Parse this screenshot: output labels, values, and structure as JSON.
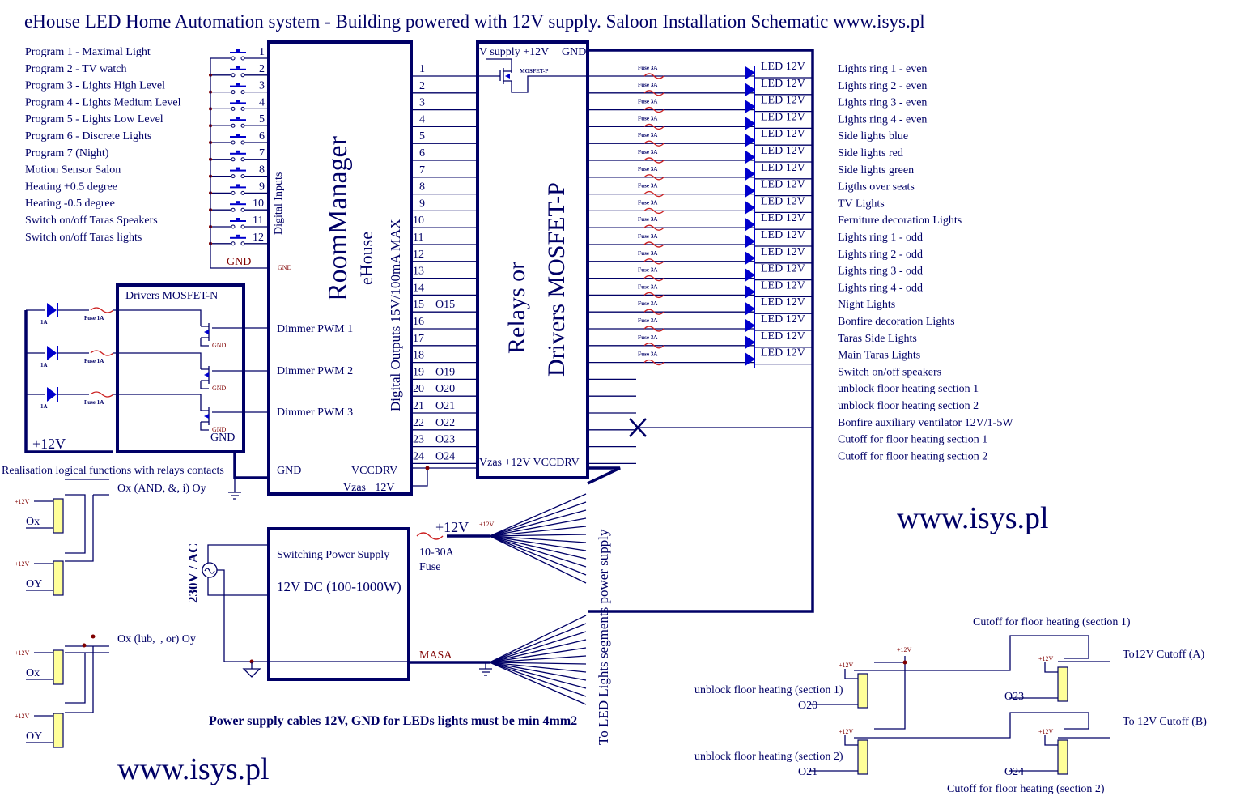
{
  "title": "eHouse LED Home Automation system - Building powered with 12V supply. Saloon Installation Schematic  www.isys.pl",
  "inputs": {
    "labels": [
      "Program 1 - Maximal Light",
      "Program 2 - TV watch",
      "Program 3 - Lights High Level",
      "Program 4 - Lights Medium Level",
      "Program 5 - Lights Low Level",
      "Program 6 - Discrete Lights",
      "Program 7 (Night)",
      "Motion Sensor Salon",
      "Heating +0.5 degree",
      "Heating -0.5 degree",
      "Switch on/off Taras Speakers",
      "Switch on/off Taras lights"
    ],
    "pins": [
      "1",
      "2",
      "3",
      "4",
      "5",
      "6",
      "7",
      "8",
      "9",
      "10",
      "11",
      "12"
    ],
    "gnd_label": "GND",
    "gnd_small": "GND",
    "section_label": "Digital Inputs"
  },
  "room_manager": {
    "name": "RoomManager",
    "brand": "eHouse",
    "outputs_label": "Digital Outputs 15V/100mA MAX",
    "dimmers": [
      "Dimmer PWM 1",
      "Dimmer PWM 2",
      "Dimmer PWM 3"
    ],
    "gnd": "GND",
    "vccdrv": "VCCDRV",
    "vzas": "Vzas +12V",
    "output_pins": [
      "1",
      "2",
      "3",
      "4",
      "5",
      "6",
      "7",
      "8",
      "9",
      "10",
      "11",
      "12",
      "13",
      "14",
      "15",
      "16",
      "17",
      "18",
      "19",
      "20",
      "21",
      "22",
      "23",
      "24"
    ],
    "output_names": {
      "15": "O15",
      "19": "O19",
      "20": "O20",
      "21": "O21",
      "22": "O22",
      "23": "O23",
      "24": "O24"
    }
  },
  "drivers_p": {
    "title_line1": "Relays or",
    "title_line2": "Drivers MOSFET-P",
    "supply": "V supply +12V",
    "gnd": "GND",
    "mosfet": "MOSFET-P",
    "bottom": "Vzas +12V  VCCDRV"
  },
  "led_outputs": {
    "fuse_label": "Fuse 3A",
    "led_label": "LED 12V",
    "count": 18
  },
  "output_descriptions": [
    "Lights ring 1 - even",
    "Lights ring 2 - even",
    "Lights ring 3 - even",
    "Lights ring 4 - even",
    "Side lights blue",
    "Side lights red",
    "Side lights green",
    "Ligths over seats",
    "TV Lights",
    "Ferniture decoration Lights",
    "Lights ring 1 - odd",
    "Lights ring 2 - odd",
    "Lights ring 3 - odd",
    "Lights ring 4 - odd",
    "Night Lights",
    "Bonfire decoration Lights",
    "Taras Side Lights",
    "Main Taras Lights",
    "Switch on/off speakers",
    "unblock floor heating  section 1",
    "unblock floor heating section 2",
    "Bonfire auxiliary ventilator 12V/1-5W",
    "Cutoff for floor heating section 1",
    "Cutoff for floor heating section 2"
  ],
  "drivers_n": {
    "title": "Drivers MOSFET-N",
    "fuse_label": "Fuse 1A",
    "led_current": "1A",
    "gnd_small": "GND",
    "gnd": "GND",
    "supply": "+12V"
  },
  "logic": {
    "title": "Realisation logical functions with relays contacts",
    "and_label": "Ox (AND, &, i) Oy",
    "or_label": "Ox (lub, |, or) Oy",
    "ox": "Ox",
    "oy": "OY",
    "v12": "+12V"
  },
  "power": {
    "ac": "230V / AC",
    "psu_line1": "Switching Power Supply",
    "psu_line2": "12V DC (100-1000W)",
    "plus12": "+12V",
    "plus12_small": "+12V",
    "fuse_value": "10-30A",
    "fuse_word": "Fuse",
    "masa": "MASA",
    "segments": "To LED Lights segments power supply",
    "cable_note": "Power supply cables 12V, GND for LEDs lights must be min 4mm2"
  },
  "heating": {
    "cutoff1_title": "Cutoff for floor heating (section 1)",
    "cutoff2_title": "Cutoff for floor heating (section 2)",
    "unblock1": "unblock floor heating (section 1)",
    "unblock2": "unblock floor heating (section 2)",
    "o20": "O20",
    "o21": "O21",
    "o23": "O23",
    "o24": "O24",
    "to_a": "To12V Cutoff (A)",
    "to_b": "To 12V Cutoff (B)",
    "v12": "+12V"
  },
  "website_right": "www.isys.pl",
  "website_left": "www.isys.pl"
}
